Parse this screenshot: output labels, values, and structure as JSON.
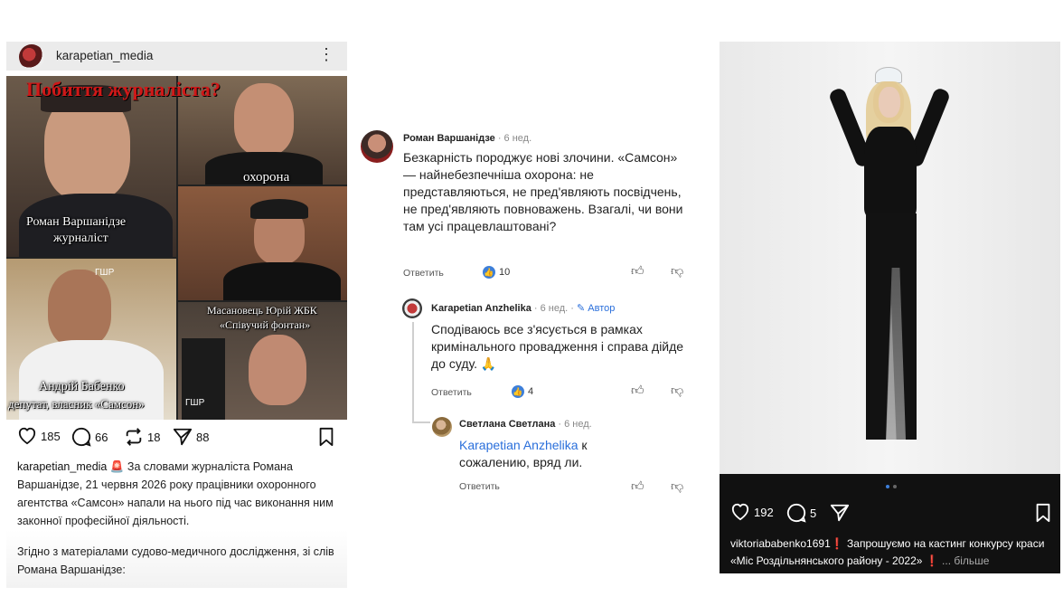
{
  "left_post": {
    "username": "karapetian_media",
    "collage": {
      "title": "Побиття журналіста?",
      "label_guard": "охорона",
      "label_journalist_name": "Роман Варшанідзе",
      "label_journalist_role": "журналіст",
      "label_masanovets_1": "Масановець Юрій ЖБК",
      "label_masanovets_2": "«Співучий фонтан»",
      "label_babenko_name": "Андрій Бабенко",
      "label_babenko_role": "депутат, власник «Самсон»",
      "badge_gshr": "ГШР"
    },
    "likes": "185",
    "comments": "66",
    "reposts": "18",
    "shares": "88",
    "caption_user": "karapetian_media",
    "caption_emoji": "🚨",
    "caption_text": " За словами журналіста Романа Варшанідзе, 21 червня 2026 року працівники охоронного агентства «Самсон» напали на нього під час виконання ним законної професійної діяльності.",
    "caption_text2": "Згідно з матеріалами судово-медичного дослідження, зі слів Романа Варшанідзе:"
  },
  "comments": {
    "c1": {
      "name": "Роман Варшанідзе",
      "meta": " · 6 нед.",
      "text": "Безкарність породжує нові злочини. «Самсон» — найнебезпечніша охорона: не представляються, не пред'являють посвідчень, не пред'являють повноважень. Взагалі, чи вони там усі працевлаштовані?",
      "reply": "Ответить",
      "likes": "10"
    },
    "c2": {
      "name": "Karapetian Anzhelika",
      "meta": " · 6 нед. · ",
      "author": "Автор",
      "text": "Сподіваюсь все з'ясується в рамках кримінального провадження і справа дійде до суду. 🙏",
      "reply": "Ответить",
      "likes": "4"
    },
    "c3": {
      "name": "Светлана Светлана",
      "meta": " · 6 нед.",
      "mention": "Karapetian Anzhelika",
      "text": " к сожалению, вряд ли.",
      "reply": "Ответить"
    }
  },
  "right_post": {
    "likes": "192",
    "comments": "5",
    "caption_user": "viktoriababenko1691",
    "caption_mark": "❗",
    "caption_text": " Запрошуємо на кастинг конкурсу краси «Міс Роздільнянського району - 2022» ",
    "caption_mark2": "❗",
    "caption_more": " ... більше"
  }
}
